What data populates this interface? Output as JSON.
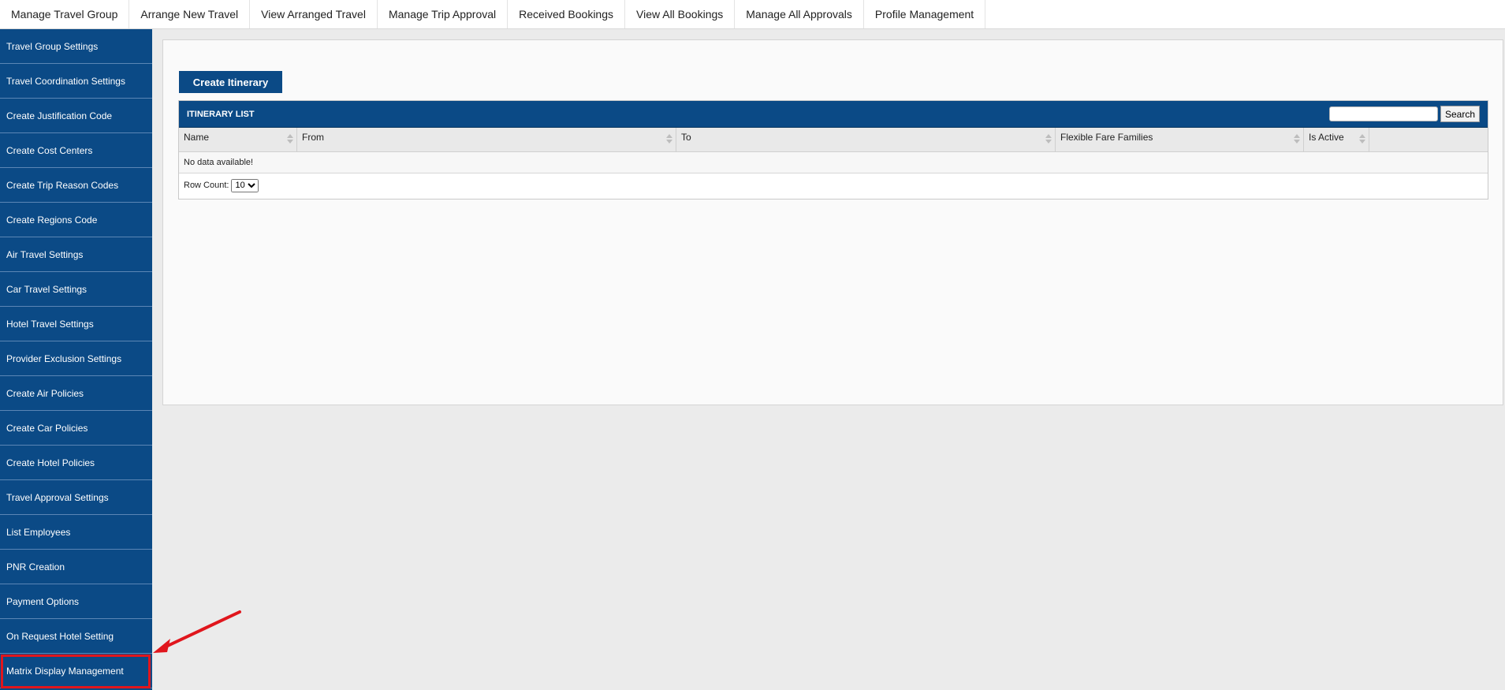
{
  "topnav": {
    "tabs": [
      "Manage Travel Group",
      "Arrange New Travel",
      "View Arranged Travel",
      "Manage Trip Approval",
      "Received Bookings",
      "View All Bookings",
      "Manage All Approvals",
      "Profile Management"
    ]
  },
  "sidebar": {
    "items": [
      "Travel Group Settings",
      "Travel Coordination Settings",
      "Create Justification Code",
      "Create Cost Centers",
      "Create Trip Reason Codes",
      "Create Regions Code",
      "Air Travel Settings",
      "Car Travel Settings",
      "Hotel Travel Settings",
      "Provider Exclusion Settings",
      "Create Air Policies",
      "Create Car Policies",
      "Create Hotel Policies",
      "Travel Approval Settings",
      "List Employees",
      "PNR Creation",
      "Payment Options",
      "On Request Hotel Setting",
      "Matrix Display Management"
    ],
    "highlighted_item": "Matrix Display Management"
  },
  "main": {
    "create_button": "Create Itinerary",
    "grid": {
      "title": "ITINERARY LIST",
      "search_value": "",
      "search_button": "Search",
      "columns": [
        "Name",
        "From",
        "To",
        "Flexible Fare Families",
        "Is Active"
      ],
      "empty_message": "No data available!",
      "row_count_label": "Row Count:",
      "row_count_value": "10"
    }
  },
  "colors": {
    "brand_blue": "#0b4a86",
    "highlight_red": "#e0161d"
  }
}
